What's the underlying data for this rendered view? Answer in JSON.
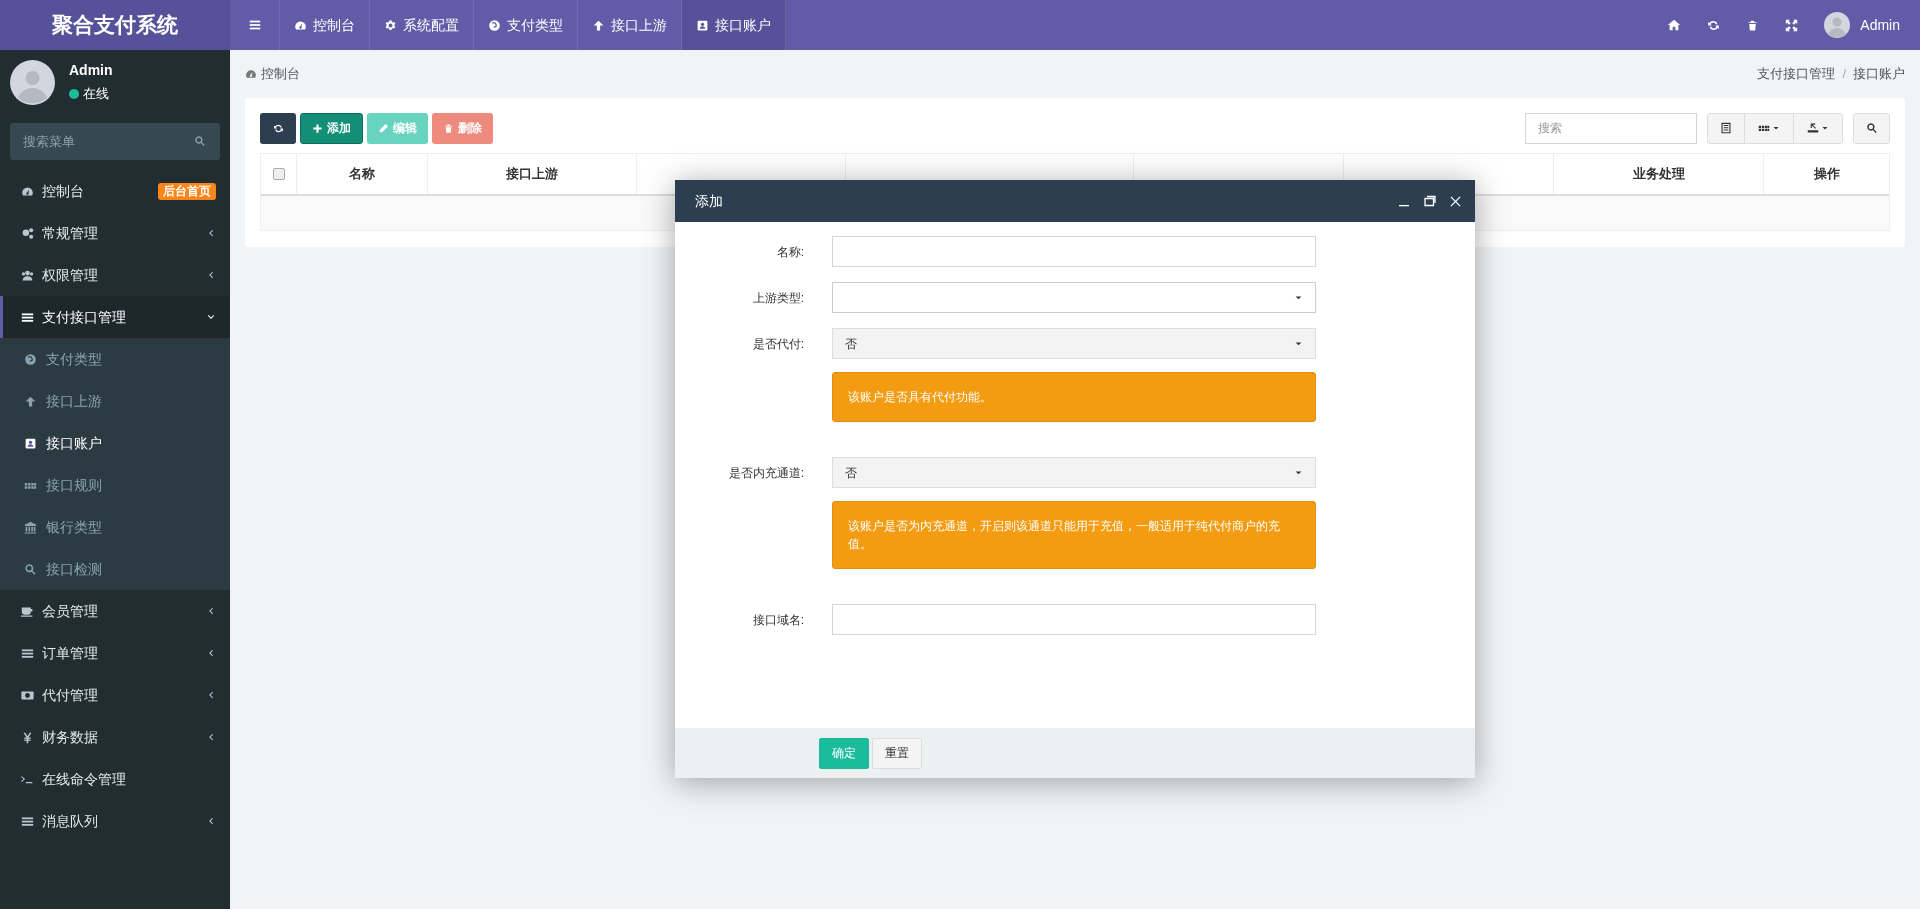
{
  "app_title": "聚合支付系统",
  "top_nav": [
    {
      "label": "控制台",
      "selected": false
    },
    {
      "label": "系统配置",
      "selected": false
    },
    {
      "label": "支付类型",
      "selected": false
    },
    {
      "label": "接口上游",
      "selected": false
    },
    {
      "label": "接口账户",
      "selected": true
    }
  ],
  "user_menu": {
    "name": "Admin"
  },
  "sidebar": {
    "user": {
      "name": "Admin",
      "status": "在线",
      "online": true
    },
    "search": {
      "placeholder": "搜索菜单"
    },
    "items": [
      {
        "label": "控制台",
        "badge": "后台首页"
      },
      {
        "label": "常规管理",
        "expanded": false
      },
      {
        "label": "权限管理",
        "expanded": false
      },
      {
        "label": "支付接口管理",
        "expanded": true,
        "children": [
          {
            "label": "支付类型",
            "selected": false
          },
          {
            "label": "接口上游",
            "selected": false
          },
          {
            "label": "接口账户",
            "selected": true
          },
          {
            "label": "接口规则",
            "selected": false
          },
          {
            "label": "银行类型",
            "selected": false
          },
          {
            "label": "接口检测",
            "selected": false
          }
        ]
      },
      {
        "label": "会员管理",
        "expanded": false
      },
      {
        "label": "订单管理",
        "expanded": false
      },
      {
        "label": "代付管理",
        "expanded": false
      },
      {
        "label": "财务数据",
        "expanded": false
      },
      {
        "label": "在线命令管理"
      },
      {
        "label": "消息队列",
        "expanded": false
      }
    ]
  },
  "breadcrumb": {
    "home": "控制台",
    "path": [
      "支付接口管理",
      "接口账户"
    ],
    "separator": "/"
  },
  "toolbar": {
    "buttons": [
      {
        "kind": "refresh"
      },
      {
        "kind": "add",
        "label": "添加",
        "disabled": false
      },
      {
        "kind": "edit",
        "label": "编辑",
        "disabled": true
      },
      {
        "kind": "delete",
        "label": "删除",
        "disabled": true
      }
    ],
    "search": {
      "placeholder": "搜索"
    }
  },
  "table": {
    "select_all_checked": false,
    "columns": [
      "名称",
      "接口上游",
      "",
      "",
      "",
      "",
      "业务处理",
      "操作"
    ]
  },
  "dialog": {
    "title": "添加",
    "fields": [
      {
        "kind": "text",
        "label": "名称:"
      },
      {
        "kind": "select",
        "label": "上游类型:"
      },
      {
        "kind": "select",
        "label": "是否代付:",
        "value": "否",
        "help": "该账户是否具有代付功能。"
      },
      {
        "kind": "select",
        "label": "是否内充通道:",
        "value": "否",
        "help": "该账户是否为内充通道，开启则该通道只能用于充值，一般适用于纯代付商户的充值。"
      },
      {
        "kind": "text",
        "label": "接口域名:"
      }
    ],
    "buttons": [
      {
        "kind": "primary",
        "label": "确定"
      },
      {
        "kind": "default",
        "label": "重置"
      }
    ]
  }
}
